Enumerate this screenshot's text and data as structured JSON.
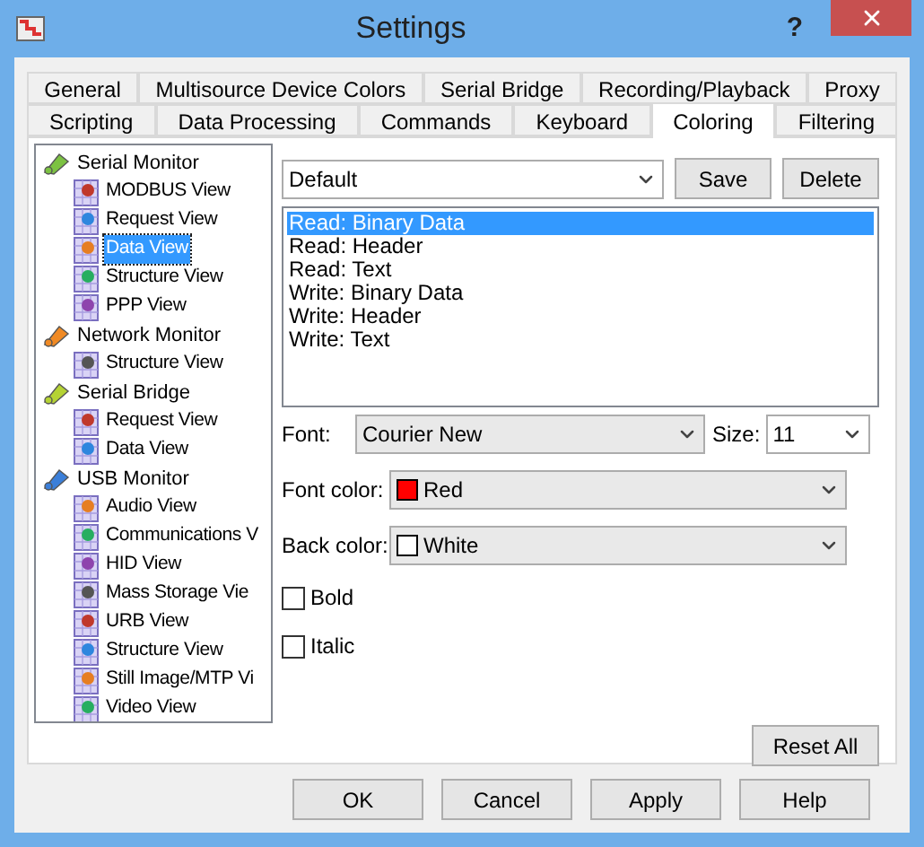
{
  "window": {
    "title": "Settings",
    "help": "?"
  },
  "tab_rows": [
    {
      "tabs": [
        {
          "label": "General",
          "selected": false
        },
        {
          "label": "Multisource Device Colors",
          "selected": false
        },
        {
          "label": "Serial Bridge",
          "selected": false
        },
        {
          "label": "Recording/Playback",
          "selected": false
        },
        {
          "label": "Proxy",
          "selected": false
        }
      ]
    },
    {
      "tabs": [
        {
          "label": "Scripting",
          "selected": false
        },
        {
          "label": "Data Processing",
          "selected": false
        },
        {
          "label": "Commands",
          "selected": false
        },
        {
          "label": "Keyboard",
          "selected": false
        },
        {
          "label": "Coloring",
          "selected": true
        },
        {
          "label": "Filtering",
          "selected": false
        }
      ]
    }
  ],
  "tree": [
    {
      "label": "Serial Monitor",
      "selected": false,
      "children": [
        {
          "label": "MODBUS View",
          "selected": false
        },
        {
          "label": "Request View",
          "selected": false
        },
        {
          "label": "Data View",
          "selected": true
        },
        {
          "label": "Structure View",
          "selected": false
        },
        {
          "label": "PPP View",
          "selected": false
        }
      ]
    },
    {
      "label": "Network Monitor",
      "selected": false,
      "children": [
        {
          "label": "Structure View",
          "selected": false
        }
      ]
    },
    {
      "label": "Serial Bridge",
      "selected": false,
      "children": [
        {
          "label": "Request View",
          "selected": false
        },
        {
          "label": "Data View",
          "selected": false
        }
      ]
    },
    {
      "label": "USB Monitor",
      "selected": false,
      "children": [
        {
          "label": "Audio View",
          "selected": false
        },
        {
          "label": "Communications V",
          "selected": false
        },
        {
          "label": "HID View",
          "selected": false
        },
        {
          "label": "Mass Storage Vie",
          "selected": false
        },
        {
          "label": "URB View",
          "selected": false
        },
        {
          "label": "Structure View",
          "selected": false
        },
        {
          "label": "Still Image/MTP Vi",
          "selected": false
        },
        {
          "label": "Video View",
          "selected": false
        }
      ]
    }
  ],
  "scheme": {
    "value": "Default"
  },
  "scheme_buttons": [
    "Save",
    "Delete"
  ],
  "elements": [
    {
      "label": "Read: Binary Data",
      "selected": true
    },
    {
      "label": "Read: Header",
      "selected": false
    },
    {
      "label": "Read: Text",
      "selected": false
    },
    {
      "label": "Write: Binary Data",
      "selected": false
    },
    {
      "label": "Write: Header",
      "selected": false
    },
    {
      "label": "Write: Text",
      "selected": false
    }
  ],
  "font": {
    "label": "Font:",
    "value": "Courier New"
  },
  "size": {
    "label": "Size:",
    "value": "11"
  },
  "colors": [
    {
      "label": "Font color:",
      "value": "Red",
      "color": "#ff0000"
    },
    {
      "label": "Back color:",
      "value": "White",
      "color": "#ffffff"
    }
  ],
  "checkboxes": [
    {
      "label": "Bold",
      "checked": false
    },
    {
      "label": "Italic",
      "checked": false
    }
  ],
  "reset_button": "Reset All",
  "footer_buttons": [
    "OK",
    "Cancel",
    "Apply",
    "Help"
  ]
}
